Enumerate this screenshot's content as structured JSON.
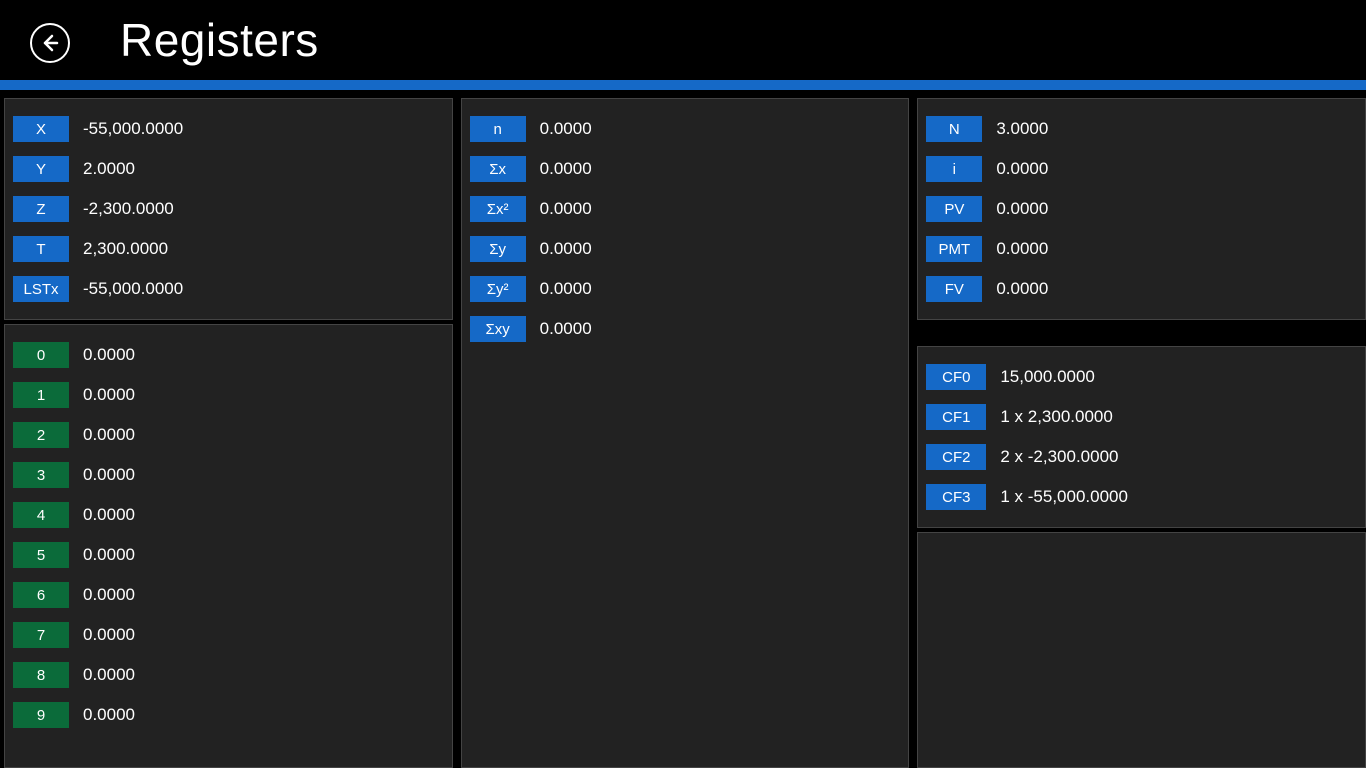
{
  "header": {
    "title": "Registers"
  },
  "colors": {
    "accent": "#1569c7",
    "green": "#0b6b3a",
    "panel": "#222",
    "bg": "#000"
  },
  "stack": [
    {
      "label": "X",
      "value": "-55,000.0000"
    },
    {
      "label": "Y",
      "value": "2.0000"
    },
    {
      "label": "Z",
      "value": "-2,300.0000"
    },
    {
      "label": "T",
      "value": "2,300.0000"
    },
    {
      "label": "LSTx",
      "value": "-55,000.0000"
    }
  ],
  "storage": [
    {
      "label": "0",
      "value": "0.0000"
    },
    {
      "label": "1",
      "value": "0.0000"
    },
    {
      "label": "2",
      "value": "0.0000"
    },
    {
      "label": "3",
      "value": "0.0000"
    },
    {
      "label": "4",
      "value": "0.0000"
    },
    {
      "label": "5",
      "value": "0.0000"
    },
    {
      "label": "6",
      "value": "0.0000"
    },
    {
      "label": "7",
      "value": "0.0000"
    },
    {
      "label": "8",
      "value": "0.0000"
    },
    {
      "label": "9",
      "value": "0.0000"
    }
  ],
  "stats": [
    {
      "label": "n",
      "value": "0.0000"
    },
    {
      "label": "Σx",
      "value": "0.0000"
    },
    {
      "label": "Σx²",
      "value": "0.0000"
    },
    {
      "label": "Σy",
      "value": "0.0000"
    },
    {
      "label": "Σy²",
      "value": "0.0000"
    },
    {
      "label": "Σxy",
      "value": "0.0000"
    }
  ],
  "tvm": [
    {
      "label": "N",
      "value": "3.0000"
    },
    {
      "label": "i",
      "value": "0.0000"
    },
    {
      "label": "PV",
      "value": "0.0000"
    },
    {
      "label": "PMT",
      "value": "0.0000"
    },
    {
      "label": "FV",
      "value": "0.0000"
    }
  ],
  "cashflow": [
    {
      "label": "CF0",
      "value": "15,000.0000"
    },
    {
      "label": "CF1",
      "value": "1 x 2,300.0000"
    },
    {
      "label": "CF2",
      "value": "2 x -2,300.0000"
    },
    {
      "label": "CF3",
      "value": "1 x -55,000.0000"
    }
  ]
}
